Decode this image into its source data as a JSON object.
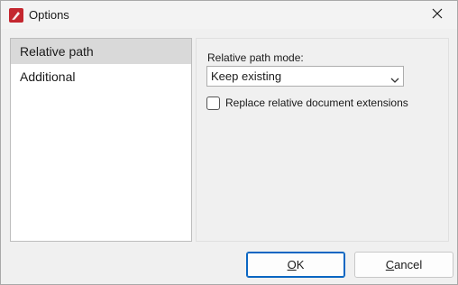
{
  "window": {
    "title": "Options"
  },
  "nav": {
    "items": [
      {
        "label": "Relative path",
        "selected": true
      },
      {
        "label": "Additional",
        "selected": false
      }
    ]
  },
  "content": {
    "mode_label": "Relative path mode:",
    "mode_value": "Keep existing",
    "checkbox_label": "Replace relative document extensions",
    "checkbox_checked": false
  },
  "buttons": {
    "ok_underlined_char": "O",
    "ok_rest": "K",
    "cancel_underlined_char": "C",
    "cancel_rest": "ancel"
  },
  "colors": {
    "accent": "#0a66c2",
    "app_icon": "#c4262e",
    "selected_bg": "#d9d9d9"
  },
  "icons": {
    "app": "pdf-editor-app-icon",
    "close": "close-icon",
    "dropdown": "chevron-down-icon"
  }
}
